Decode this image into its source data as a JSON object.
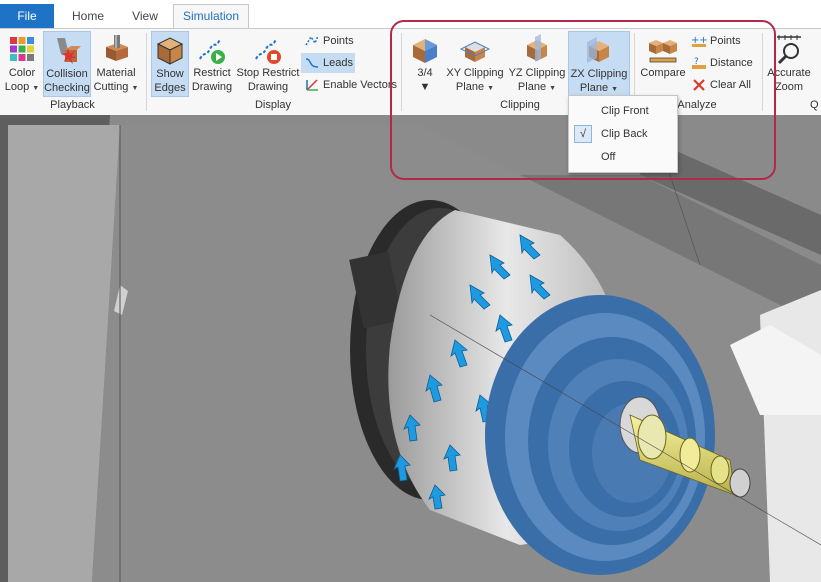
{
  "tabs": {
    "file": "File",
    "home": "Home",
    "view": "View",
    "simulation": "Simulation"
  },
  "playback": {
    "group": "Playback",
    "color_loop": [
      "Color",
      "Loop"
    ],
    "collision_checking": [
      "Collision",
      "Checking"
    ],
    "material_cutting": [
      "Material",
      "Cutting"
    ]
  },
  "display": {
    "group": "Display",
    "show_edges": [
      "Show",
      "Edges"
    ],
    "restrict_drawing": [
      "Restrict",
      "Drawing"
    ],
    "stop_restrict_drawing": [
      "Stop Restrict",
      "Drawing"
    ],
    "points": "Points",
    "leads": "Leads",
    "enable_vectors": "Enable Vectors"
  },
  "clipping": {
    "group": "Clipping",
    "three_quarter": "3/4",
    "xy_plane": [
      "XY Clipping",
      "Plane"
    ],
    "yz_plane": [
      "YZ Clipping",
      "Plane"
    ],
    "zx_plane": [
      "ZX Clipping",
      "Plane"
    ]
  },
  "analyze": {
    "group": "Analyze",
    "compare": "Compare",
    "points": "Points",
    "distance": "Distance",
    "clear_all": "Clear All"
  },
  "quick": {
    "accurate_zoom": [
      "Accurate",
      "Zoom"
    ],
    "partial": "Q"
  },
  "dropdown": {
    "clip_front": "Clip Front",
    "clip_back": "Clip Back",
    "off": "Off",
    "check": "√"
  },
  "colors": {
    "accent": "#1e73c6",
    "selected": "#c5dcf2",
    "highlight": "#b4284b",
    "arrows": "#1e9be0"
  }
}
